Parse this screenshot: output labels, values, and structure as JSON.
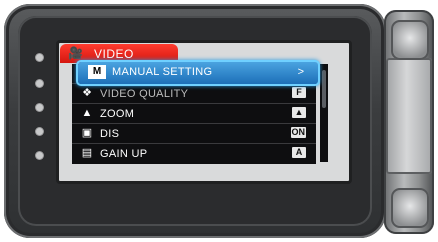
{
  "menu": {
    "title": "VIDEO",
    "title_icon": "movie-camera-icon",
    "items": [
      {
        "label": "MANUAL SETTING",
        "icon_text": "M",
        "icon": "manual-icon",
        "value": ">",
        "selected": true
      },
      {
        "label": "VIDEO QUALITY",
        "icon_text": "❖",
        "icon": "video-quality-icon",
        "value": "F"
      },
      {
        "label": "ZOOM",
        "icon_text": "▲",
        "icon": "zoom-icon",
        "value": "▲"
      },
      {
        "label": "DIS",
        "icon_text": "▣",
        "icon": "dis-icon",
        "value": "ON"
      },
      {
        "label": "GAIN UP",
        "icon_text": "▤",
        "icon": "gain-up-icon",
        "value": "A"
      }
    ]
  }
}
